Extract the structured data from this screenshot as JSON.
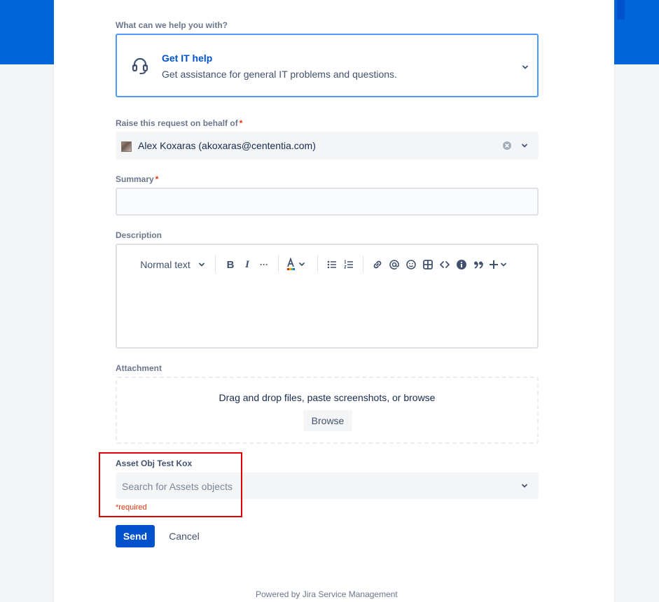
{
  "request_type": {
    "label": "What can we help you with?",
    "title": "Get IT help",
    "description": "Get assistance for general IT problems and questions.",
    "icon": "headset-icon"
  },
  "on_behalf": {
    "label": "Raise this request on behalf of",
    "required_mark": "*",
    "value": "Alex Koxaras (akoxaras@cententia.com)"
  },
  "summary": {
    "label": "Summary",
    "required_mark": "*",
    "value": ""
  },
  "description": {
    "label": "Description",
    "toolbar": {
      "text_style": "Normal text",
      "bold": "B",
      "italic": "I",
      "more": "···"
    }
  },
  "attachment": {
    "label": "Attachment",
    "drop_text": "Drag and drop files, paste screenshots, or browse",
    "browse_label": "Browse"
  },
  "asset": {
    "label": "Asset Obj Test Kox",
    "placeholder": "Search for Assets objects",
    "required_msg": "*required"
  },
  "actions": {
    "send_label": "Send",
    "cancel_label": "Cancel"
  },
  "footer": {
    "text": "Powered by Jira Service Management"
  },
  "colors": {
    "brand": "#0065d8",
    "primary_button": "#0052cc",
    "focus_border": "#4c9aff",
    "required": "#de350b",
    "highlight": "#e00000"
  }
}
